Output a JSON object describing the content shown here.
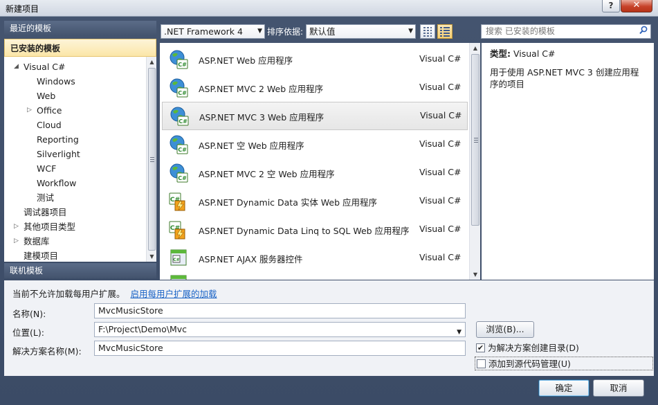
{
  "window": {
    "title": "新建项目",
    "help_label": "?",
    "close_label": "✕"
  },
  "left": {
    "recent_label": "最近的模板",
    "installed_label": "已安装的模板",
    "online_label": "联机模板",
    "tree": [
      {
        "label": "Visual C#",
        "expand": "◢"
      },
      {
        "label": "Windows"
      },
      {
        "label": "Web"
      },
      {
        "label": "Office",
        "expand": "▷"
      },
      {
        "label": "Cloud"
      },
      {
        "label": "Reporting"
      },
      {
        "label": "Silverlight"
      },
      {
        "label": "WCF"
      },
      {
        "label": "Workflow"
      },
      {
        "label": "测试"
      },
      {
        "label": "调试器项目"
      },
      {
        "label": "其他项目类型",
        "expand": "▷"
      },
      {
        "label": "数据库",
        "expand": "▷"
      },
      {
        "label": "建模项目"
      }
    ]
  },
  "toolbar": {
    "framework": ".NET Framework 4",
    "sort_label": "排序依据:",
    "sort_value": "默认值",
    "search_placeholder": "搜索 已安装的模板"
  },
  "templates": [
    {
      "name": "ASP.NET Web 应用程序",
      "lang": "Visual C#",
      "icon": "globe-csharp-icon"
    },
    {
      "name": "ASP.NET MVC 2 Web 应用程序",
      "lang": "Visual C#",
      "icon": "globe-csharp-icon"
    },
    {
      "name": "ASP.NET MVC 3 Web 应用程序",
      "lang": "Visual C#",
      "icon": "globe-csharp-icon",
      "selected": true
    },
    {
      "name": "ASP.NET 空 Web 应用程序",
      "lang": "Visual C#",
      "icon": "globe-csharp-icon"
    },
    {
      "name": "ASP.NET MVC 2 空 Web 应用程序",
      "lang": "Visual C#",
      "icon": "globe-csharp-icon"
    },
    {
      "name": "ASP.NET Dynamic Data 实体 Web 应用程序",
      "lang": "Visual C#",
      "icon": "csharp-lightning-icon"
    },
    {
      "name": "ASP.NET Dynamic Data Linq to SQL Web 应用程序",
      "lang": "Visual C#",
      "icon": "csharp-lightning-icon"
    },
    {
      "name": "ASP.NET AJAX 服务器控件",
      "lang": "Visual C#",
      "icon": "window-csharp-icon"
    }
  ],
  "details": {
    "type_label": "类型:",
    "type_value": "Visual C#",
    "description": "用于使用 ASP.NET MVC 3 创建应用程序的项目"
  },
  "bottom": {
    "notice": "当前不允许加载每用户扩展。",
    "notice_link": "启用每用户扩展的加载",
    "name_label": "名称(N):",
    "name_value": "MvcMusicStore",
    "location_label": "位置(L):",
    "location_value": "F:\\Project\\Demo\\Mvc",
    "solution_label": "解决方案名称(M):",
    "solution_value": "MvcMusicStore",
    "browse_label": "浏览(B)...",
    "create_dir_label": "为解决方案创建目录(D)",
    "create_dir_checked": true,
    "source_control_label": "添加到源代码管理(U)",
    "source_control_checked": false
  },
  "buttons": {
    "ok": "确定",
    "cancel": "取消"
  },
  "colors": {
    "link": "#1b64c6",
    "selection_header": "#fbe6a8",
    "panel_header": "#43536d"
  }
}
